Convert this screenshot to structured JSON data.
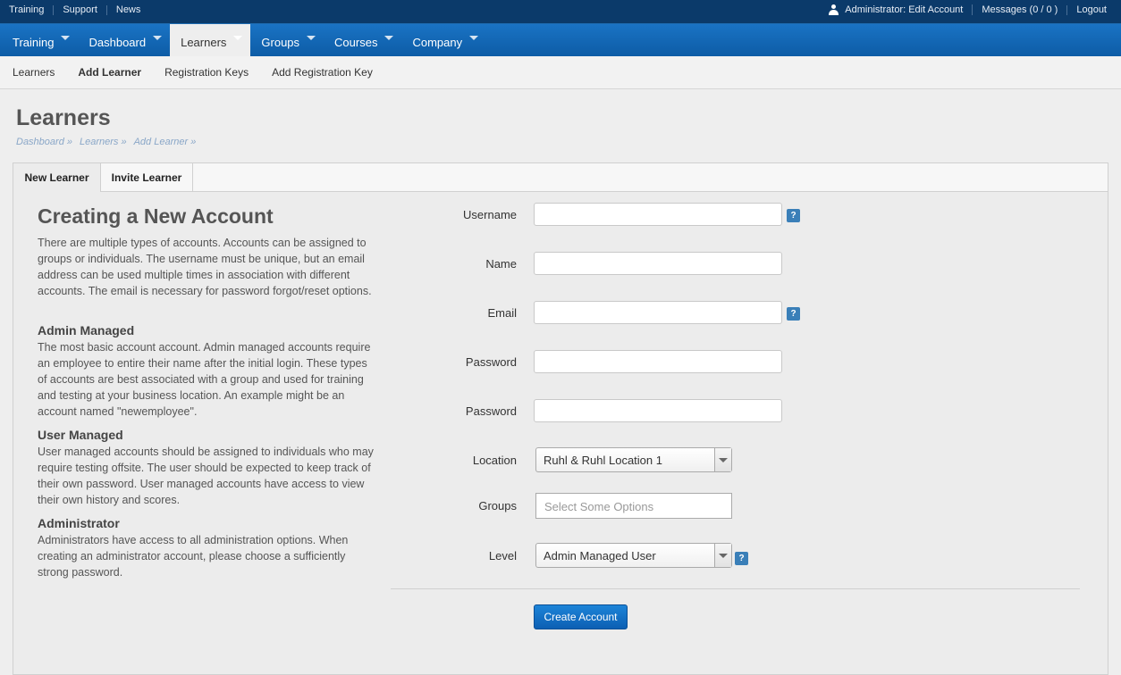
{
  "topbar": {
    "links": [
      "Training",
      "Support",
      "News"
    ],
    "account": "Administrator: Edit Account",
    "messages": "Messages (0 / 0 )",
    "logout": "Logout"
  },
  "mainnav": {
    "items": [
      {
        "label": "Training"
      },
      {
        "label": "Dashboard"
      },
      {
        "label": "Learners",
        "active": true
      },
      {
        "label": "Groups"
      },
      {
        "label": "Courses"
      },
      {
        "label": "Company"
      }
    ]
  },
  "subnav": {
    "items": [
      {
        "label": "Learners"
      },
      {
        "label": "Add Learner",
        "active": true
      },
      {
        "label": "Registration Keys"
      },
      {
        "label": "Add Registration Key"
      }
    ]
  },
  "page": {
    "title": "Learners",
    "breadcrumb": [
      "Dashboard »",
      "Learners »",
      "Add Learner »"
    ]
  },
  "tabs": [
    "New Learner",
    "Invite Learner"
  ],
  "info": {
    "title": "Creating a New Account",
    "intro": "There are multiple types of accounts. Accounts can be assigned to groups or individuals. The username must be unique, but an email address can be used multiple times in association with different accounts. The email is necessary for password forgot/reset options.",
    "sections": [
      {
        "heading": "Admin Managed",
        "text": "The most basic account account. Admin managed accounts require an employee to entire their name after the initial login. These types of accounts are best associated with a group and used for training and testing at your business location. An example might be an account named \"newemployee\"."
      },
      {
        "heading": "User Managed",
        "text": "User managed accounts should be assigned to individuals who may require testing offsite. The user should be expected to keep track of their own password. User managed accounts have access to view their own history and scores."
      },
      {
        "heading": "Administrator",
        "text": "Administrators have access to all administration options. When creating an administrator account, please choose a sufficiently strong password."
      }
    ]
  },
  "form": {
    "username_label": "Username",
    "name_label": "Name",
    "email_label": "Email",
    "password_label": "Password",
    "password2_label": "Password",
    "location_label": "Location",
    "location_value": "Ruhl & Ruhl Location 1",
    "groups_label": "Groups",
    "groups_placeholder": "Select Some Options",
    "level_label": "Level",
    "level_value": "Admin Managed User",
    "help_glyph": "?",
    "submit_label": "Create Account",
    "username_value": "",
    "name_value": "",
    "email_value": "",
    "password_value": "",
    "password2_value": ""
  },
  "colors": {
    "topbar": "#0b3a6a",
    "nav": "#1a73c4",
    "accent_button": "#1d84d8",
    "help_icon": "#3a7fb8"
  }
}
